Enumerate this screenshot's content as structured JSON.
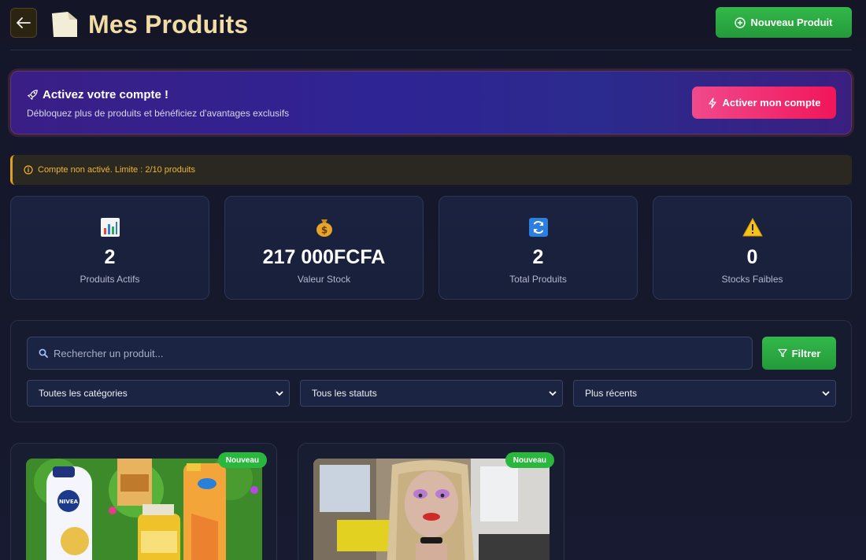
{
  "header": {
    "title": "Mes Produits",
    "new_product_label": "Nouveau Produit",
    "icons": [
      "arrow-left-icon",
      "logo-tile",
      "plus-circle-icon"
    ]
  },
  "promo": {
    "title": "Activez votre compte !",
    "subtitle": "Débloquez plus de produits et bénéficiez d'avantages exclusifs",
    "button_label": "Activer mon compte",
    "icons": [
      "rocket-icon",
      "lightning-icon"
    ]
  },
  "warning": {
    "text": "Compte non activé. Limite : 2/10 produits",
    "icon": "info-icon"
  },
  "stats": [
    {
      "value": "2",
      "label": "Produits Actifs",
      "icon": "bar-chart-icon"
    },
    {
      "value": "217 000FCFA",
      "label": "Valeur Stock",
      "icon": "money-bag-icon"
    },
    {
      "value": "2",
      "label": "Total Produits",
      "icon": "refresh-icon"
    },
    {
      "value": "0",
      "label": "Stocks Faibles",
      "icon": "warning-icon"
    }
  ],
  "filters": {
    "search_placeholder": "Rechercher un produit...",
    "filter_label": "Filtrer",
    "category_select": "Toutes les catégories",
    "status_select": "Tous les statuts",
    "sort_select": "Plus récents"
  },
  "products": [
    {
      "badge": "Nouveau",
      "image": "cosmetics-products-photo"
    },
    {
      "badge": "Nouveau",
      "image": "wig-mannequin-photo"
    }
  ],
  "colors": {
    "background": "#141628",
    "title_gold": "#f0dca4",
    "green_button": "#2aa642",
    "pink_button": "#f2155a",
    "warning_amber": "#f0b432"
  }
}
